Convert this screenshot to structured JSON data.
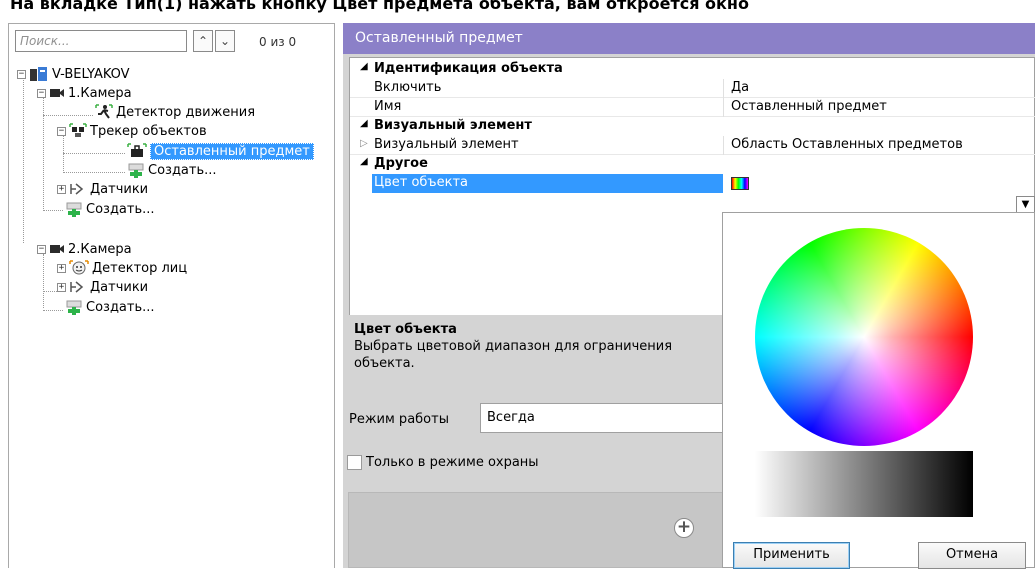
{
  "top_strip_text": "На вкладке Тип(1) нажать кнопку Цвет предмета объекта, вам откроется окно",
  "search": {
    "placeholder": "Поиск...",
    "counter": "0 из 0"
  },
  "tree": {
    "server": "V-BELYAKOV",
    "camera1": "1.Камера",
    "motion_detector": "Детектор движения",
    "object_tracker": "Трекер объектов",
    "abandoned_object": "Оставленный предмет",
    "create_1": "Создать...",
    "sensors_1": "Датчики",
    "create_2": "Создать...",
    "camera2": "2.Камера",
    "face_detector": "Детектор лиц",
    "sensors_2": "Датчики",
    "create_3": "Создать..."
  },
  "panel": {
    "title": "Оставленный предмет",
    "categories": {
      "identification": "Идентификация объекта",
      "visual": "Визуальный элемент",
      "other": "Другое"
    },
    "rows": {
      "enable_key": "Включить",
      "enable_val": "Да",
      "name_key": "Имя",
      "name_val": "Оставленный предмет",
      "visual_key": "Визуальный элемент",
      "visual_val": "Область Оставленных предметов",
      "color_key": "Цвет объекта"
    },
    "description": {
      "title": "Цвет объекта",
      "text": "Выбрать цветовой диапазон для ограничения объекта."
    },
    "mode_label": "Режим работы",
    "mode_value": "Всегда",
    "guard_only": "Только в режиме охраны"
  },
  "color_picker": {
    "apply": "Применить",
    "cancel": "Отмена"
  }
}
